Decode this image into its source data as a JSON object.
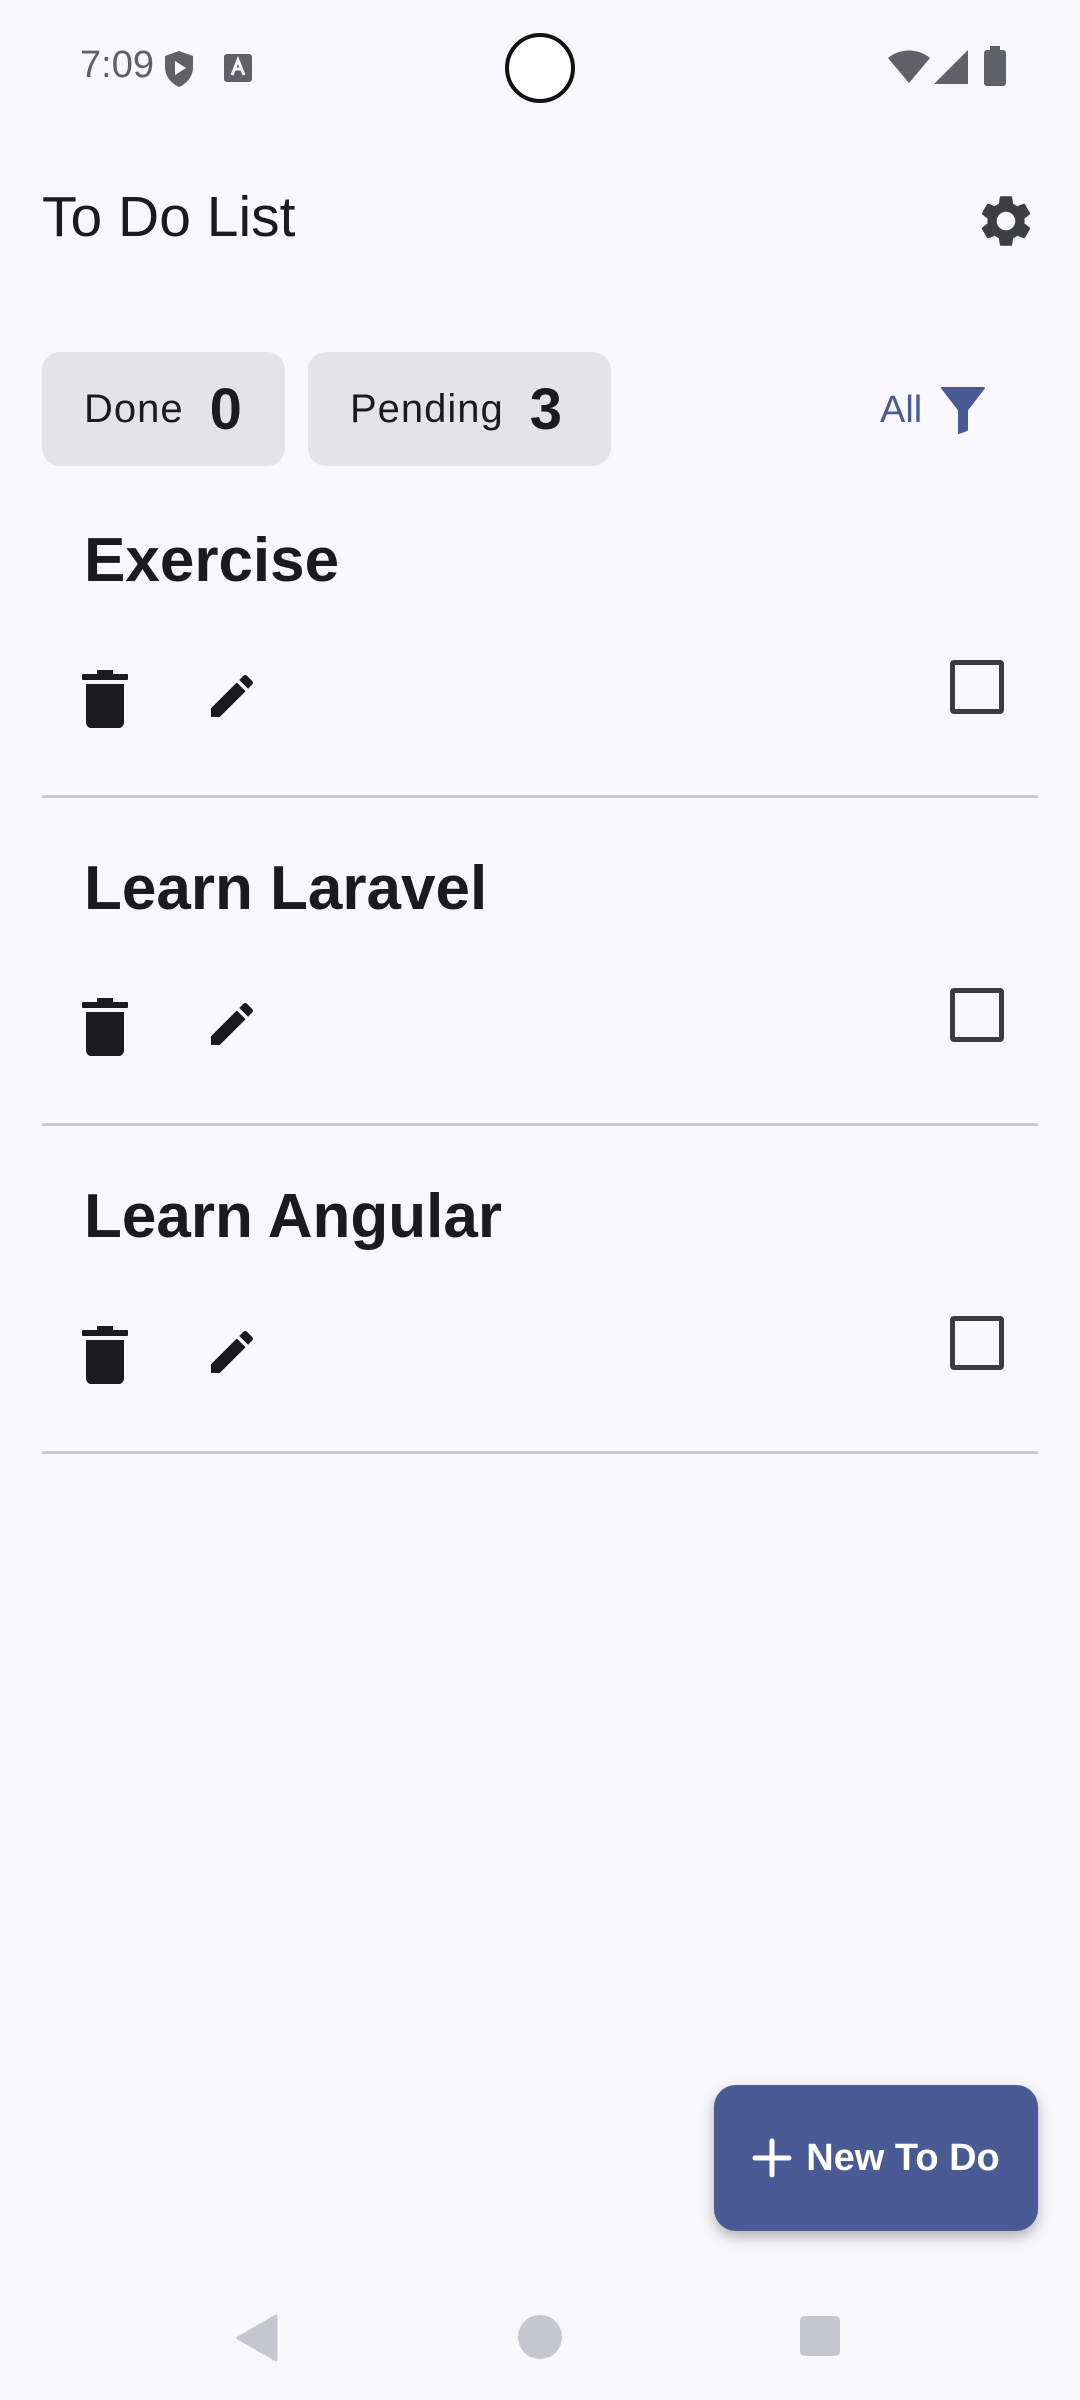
{
  "status_bar": {
    "time": "7:09",
    "icons": [
      "shield-play-icon",
      "accessibility-a-icon",
      "wifi-icon",
      "cell-signal-icon",
      "battery-icon"
    ]
  },
  "app_bar": {
    "title": "To Do List",
    "settings_icon": "gear-icon"
  },
  "summary": {
    "done_label": "Done",
    "done_count": "0",
    "pending_label": "Pending",
    "pending_count": "3"
  },
  "filter": {
    "label": "All",
    "icon": "filter-icon"
  },
  "todos": [
    {
      "title": "Exercise",
      "done": false
    },
    {
      "title": "Learn Laravel",
      "done": false
    },
    {
      "title": "Learn Angular",
      "done": false
    }
  ],
  "fab": {
    "label": "New To Do",
    "icon": "plus-icon"
  },
  "nav_bar": {
    "icons": [
      "back-icon",
      "home-icon",
      "recents-icon"
    ]
  },
  "colors": {
    "accent": "#4a5a94",
    "background": "#f7f7fc",
    "chip": "#e3e3e8",
    "text": "#1b1b1f",
    "divider": "#c9c9ce"
  }
}
